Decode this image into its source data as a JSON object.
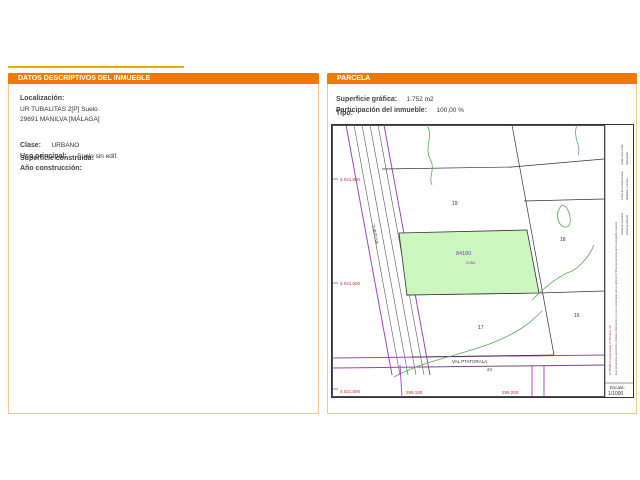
{
  "left_panel": {
    "title": "DATOS DESCRIPTIVOS DEL INMUEBLE",
    "localizacion_label": "Localización:",
    "localizacion_line1": "UR TUBALITAS 2[P] Suelo",
    "localizacion_line2": "29691 MANILVA [MÁLAGA]",
    "clase_label": "Clase:",
    "clase_value": "URBANO",
    "uso_label": "Uso principal:",
    "uso_value": "Suelo sin edif.",
    "superficie_label": "Superficie construida:",
    "ano_label": "Año construcción:"
  },
  "right_panel": {
    "title": "PARCELA",
    "superficie_grafica_label": "Superficie gráfica:",
    "superficie_grafica_value": "1.752 m2",
    "participacion_label": "Participación del inmueble:",
    "participacion_value": "100,00 %",
    "tipo_label": "Tipo:"
  },
  "map": {
    "highlight_color": "#ccf5c0",
    "parcel_ref": "84180",
    "parcel_sub": "ZUBA",
    "parcel_numbers": [
      "19",
      "18",
      "17",
      "16",
      "24"
    ],
    "coords_y": [
      "4.021.800",
      "4.021.600",
      "4.021.500"
    ],
    "coords_x": [
      "299.180",
      "299.200"
    ],
    "road_label": "TUBITOVA",
    "street_label": "VAL PTATORALA",
    "scale_label": "Escala:",
    "scale_value": "1/1000",
    "legend_items": [
      "Límite de manzana",
      "Límite de parcela",
      "Límite de construcciones",
      "Mobiliario y aceras",
      "Límite zona verde",
      "Hidrografía"
    ],
    "legend_note": "Este documento electrónico contiene información con los coordenadas de los vértices UTM de las parcelas de la cartografía catastral",
    "utm_note": "ETRS89 Coordenadas UTM Huso 30"
  }
}
